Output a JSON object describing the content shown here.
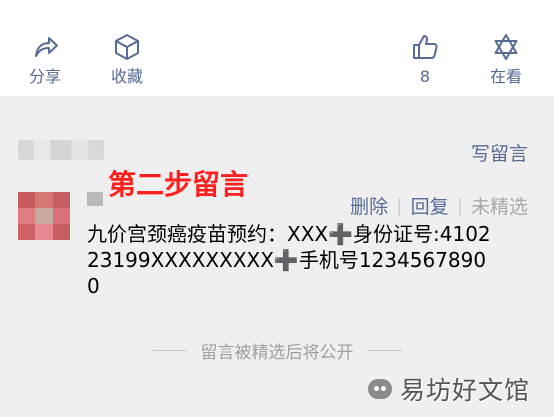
{
  "actions": {
    "share_label": "分享",
    "favorite_label": "收藏",
    "like_count": "8",
    "viewing_label": "在看"
  },
  "comments_header": {
    "write_label": "写留言"
  },
  "annotation": {
    "text": "第二步留言"
  },
  "comment": {
    "delete_label": "删除",
    "reply_label": "回复",
    "not_featured_label": "未精选",
    "content": "九价宫颈癌疫苗预约：XXX➕身份证号:410223199XXXXXXXXX➕手机号12345678900"
  },
  "footer": {
    "notice": "留言被精选后将公开"
  },
  "watermark": {
    "text": "易坊好文馆"
  },
  "colors": {
    "link": "#576b95",
    "background": "#efefef",
    "annotation": "#ff1f1f",
    "muted": "#a8a8a8"
  }
}
